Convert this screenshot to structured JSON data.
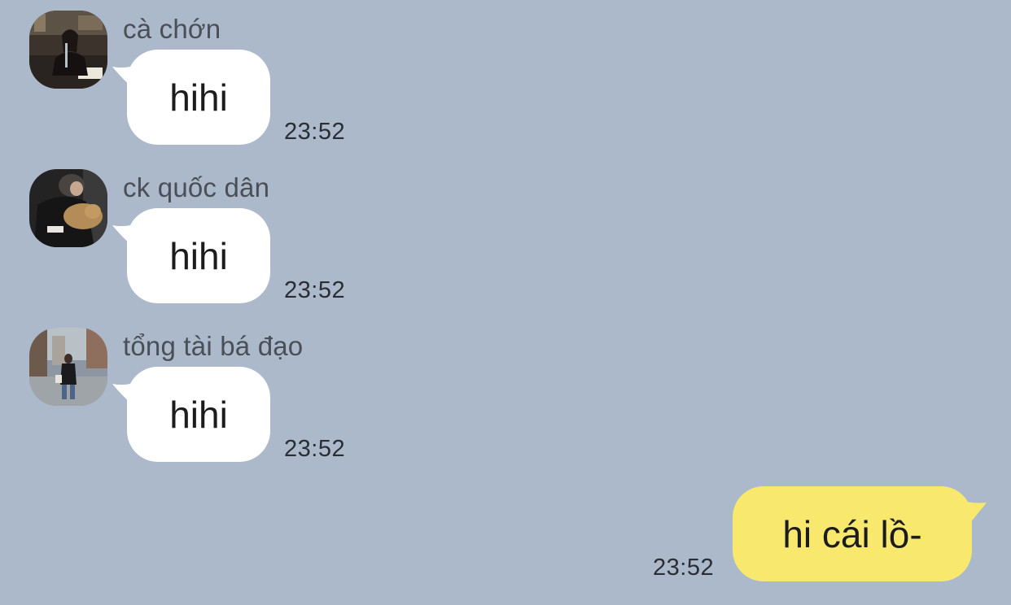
{
  "colors": {
    "background": "#abb9cb",
    "incoming_bubble": "#ffffff",
    "outgoing_bubble": "#f9e86e",
    "sender_name": "#4a4f57",
    "timestamp": "#2a2d33"
  },
  "messages": [
    {
      "sender": "cà chớn",
      "text": "hihi",
      "time": "23:52",
      "avatar_icon": "user-photo-avatar"
    },
    {
      "sender": "ck quốc dân",
      "text": "hihi",
      "time": "23:52",
      "avatar_icon": "user-photo-avatar"
    },
    {
      "sender": "tổng tài bá đạo",
      "text": "hihi",
      "time": "23:52",
      "avatar_icon": "user-photo-avatar"
    }
  ],
  "outgoing": {
    "text": "hi cái lồ-",
    "time": "23:52"
  }
}
